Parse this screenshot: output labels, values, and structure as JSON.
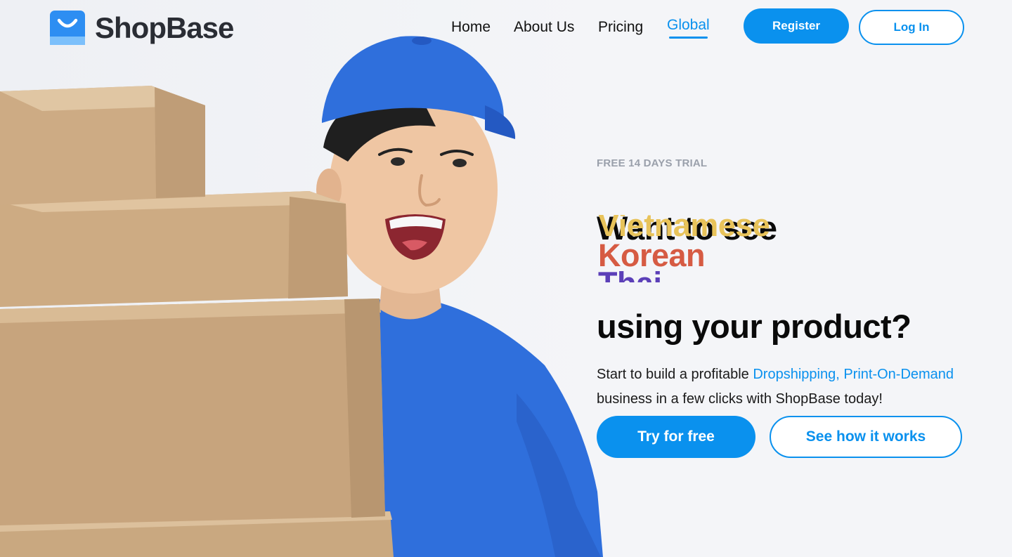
{
  "brand": {
    "name": "ShopBase",
    "logo_icon": "shopping-bag-icon",
    "primary_color": "#0a91ee",
    "logo_color": "#2d8ef2"
  },
  "nav": {
    "items": [
      {
        "label": "Home"
      },
      {
        "label": "About Us"
      },
      {
        "label": "Pricing"
      },
      {
        "label": "Global"
      }
    ],
    "active": "Global",
    "register_label": "Register",
    "login_label": "Log In"
  },
  "hero": {
    "eyebrow": "FREE 14 DAYS TRIAL",
    "headline_top": "Want to see",
    "rotating_words": [
      {
        "text": "Vietnamese",
        "color": "#e8c35a"
      },
      {
        "text": "Korean",
        "color": "#d65b43"
      },
      {
        "text": "Thai",
        "color": "#5b3fb8"
      }
    ],
    "headline_bottom": "using your product?",
    "subtext_before": "Start to build a profitable ",
    "subtext_highlight": "Dropshipping, Print-On-Demand",
    "subtext_after": " business in a few clicks with ShopBase today!",
    "cta_primary": "Try for free",
    "cta_secondary": "See how it works"
  }
}
